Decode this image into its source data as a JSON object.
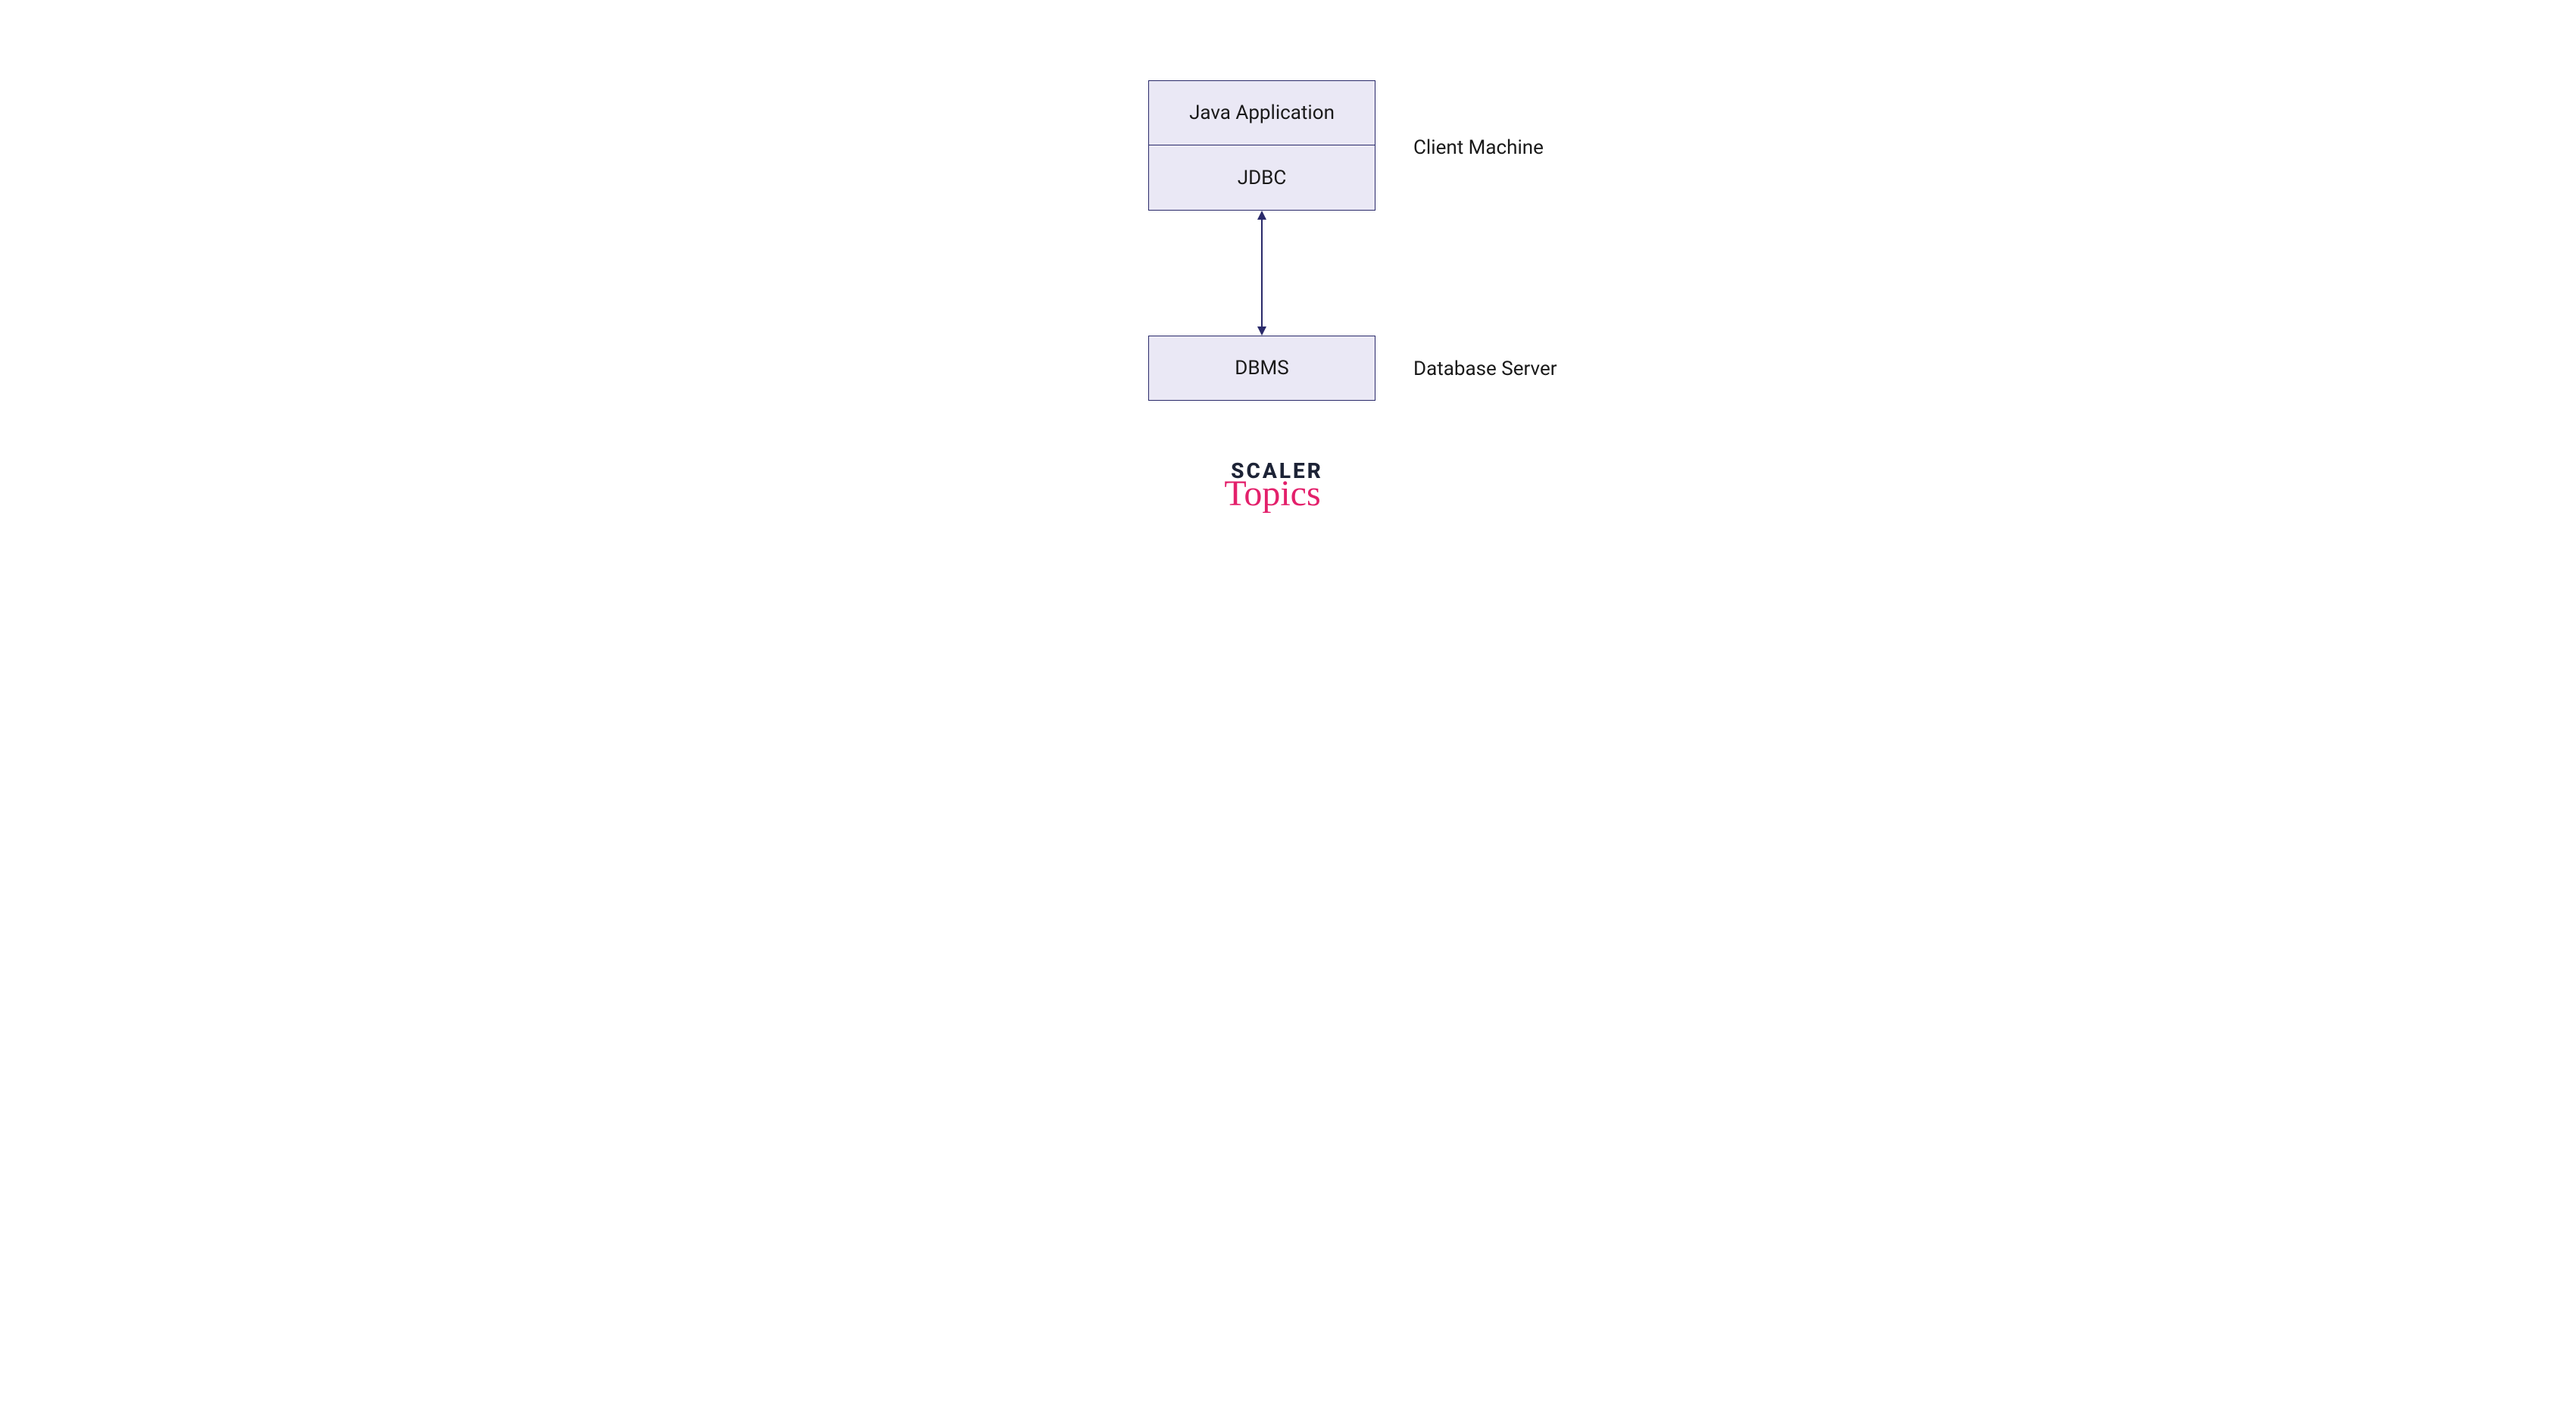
{
  "boxes": {
    "java_app": "Java Application",
    "jdbc": "JDBC",
    "dbms": "DBMS"
  },
  "labels": {
    "client": "Client Machine",
    "server": "Database Server"
  },
  "logo": {
    "top": "SCALER",
    "bottom": "Topics"
  },
  "colors": {
    "box_bg": "#eae8f5",
    "box_border": "#2a2a6a",
    "arrow": "#2a2a6a",
    "text": "#1a1a1a",
    "logo_dark": "#1d2336",
    "logo_pink": "#e3206b"
  }
}
